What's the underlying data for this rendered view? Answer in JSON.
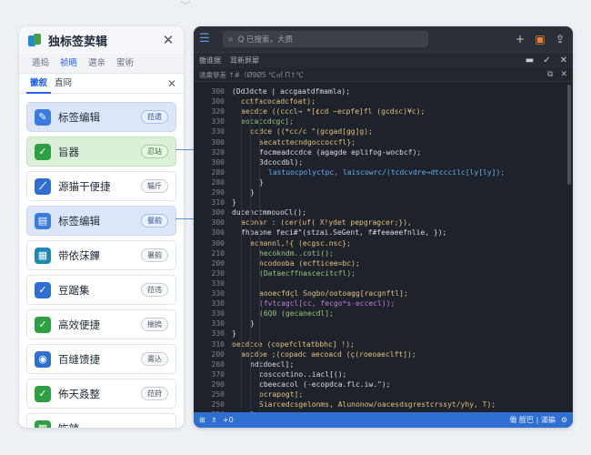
{
  "left": {
    "title": "独标签荬辑",
    "tabs": [
      "遁捣",
      "祯晤",
      "選亲",
      "蜜術"
    ],
    "subtabs": [
      "黴叙",
      "直冏"
    ],
    "items": [
      {
        "label": "标签编辑",
        "pill": "菈遗",
        "style": "blue",
        "icon": "tag-edit-icon",
        "color": "#3b7be0"
      },
      {
        "label": "旨器",
        "pill": "忍站",
        "style": "green",
        "icon": "check-icon",
        "color": "#2ea043"
      },
      {
        "label": "源猫干便捷",
        "pill": "辎斤",
        "style": "",
        "icon": "pen-icon",
        "color": "#2f6fd1"
      },
      {
        "label": "标签编辑",
        "pill": "餐韵",
        "style": "blue",
        "icon": "card-icon",
        "color": "#3b7be0"
      },
      {
        "label": "带依莯饆",
        "pill": "暑韵",
        "style": "",
        "icon": "building-icon",
        "color": "#1e88b0"
      },
      {
        "label": "豆踞集",
        "pill": "菈违",
        "style": "",
        "icon": "check-icon",
        "color": "#2f6fd1"
      },
      {
        "label": "高效便捷",
        "pill": "揣摀",
        "style": "",
        "icon": "check-icon",
        "color": "#2ea043"
      },
      {
        "label": "百缝馈捷",
        "pill": "晝込",
        "style": "",
        "icon": "user-icon",
        "color": "#2f6fd1"
      },
      {
        "label": "佈天叒整",
        "pill": "菈荮",
        "style": "",
        "icon": "check-icon",
        "color": "#2ea043"
      },
      {
        "label": "饬辣",
        "pill": "",
        "style": "",
        "icon": "building-icon",
        "color": "#2ea043"
      }
    ]
  },
  "right": {
    "search_placeholder": "Q 已搜索，大质",
    "bar2": [
      "雒谁据",
      "耳新屛犀"
    ],
    "bar3": "通羹孽差 ↑#（Ø9Ø5 ℃㎡ Π↑℃",
    "status_left": [
      "⊞",
      "♗",
      "+0"
    ],
    "status_right": "㒈 酲巴 | 滿徧",
    "line_numbers": [
      "300",
      "300",
      "320",
      "330",
      "330",
      "300",
      "320",
      "300",
      "280",
      "280",
      "290",
      "310",
      "300",
      "300",
      "300",
      "300",
      "210",
      "200",
      "230",
      "330",
      "330",
      "330",
      "330",
      "330",
      "330",
      "310",
      "200",
      "260",
      "370",
      "290",
      "250",
      "250",
      "210",
      "210",
      "230"
    ],
    "code_lines": [
      {
        "i": 0,
        "t": "(DdJdcte | accgaatdfmamla);",
        "c": "#d8dde5"
      },
      {
        "i": 1,
        "t": "cctfacocadcfoat);",
        "c": "#e5c07b"
      },
      {
        "i": 1,
        "t": "aecdce ((cccl→ *[¢cd ~ecpfe]fl (gcdsc)¥c);",
        "c": "#e5c07b"
      },
      {
        "i": 1,
        "t": "eocaccdcgc];",
        "c": "#98c379"
      },
      {
        "i": 2,
        "t": "ccdce ((*cc/c \"(gcgad[gg]g);",
        "c": "#e5c07b"
      },
      {
        "i": 3,
        "t": "secatctecndgoccoccfl};",
        "c": "#e5c07b"
      },
      {
        "i": 3,
        "t": "focmeadccdce (agagde eplifog-wocbcf);",
        "c": "#d8dde5"
      },
      {
        "i": 3,
        "t": "3dcocdbl);",
        "c": "#d8dde5"
      },
      {
        "i": 4,
        "t": "lastuocpolyctpc, laiscowrc/(tcdcvdre→dtcccilc[ly[ly]);",
        "c": "#61afef"
      },
      {
        "i": 3,
        "t": "}",
        "c": "#d8dde5"
      },
      {
        "i": 2,
        "t": "}",
        "c": "#d8dde5"
      },
      {
        "i": 0,
        "t": "}",
        "c": "#d8dde5"
      },
      {
        "i": 0,
        "t": "ducenctmmouoCl();",
        "c": "#d8dde5"
      },
      {
        "i": 1,
        "t": "aconar : (cer(uf( X!ydet pepgragcer;}),",
        "c": "#e5c07b"
      },
      {
        "i": 1,
        "t": "fhoabne feci#\"(stzai.SeGent, f#feeaeefnlie, });",
        "c": "#d8dde5"
      },
      {
        "i": 2,
        "t": "ecmannl,!{ (ecgsc.nsc};",
        "c": "#e5c07b"
      },
      {
        "i": 3,
        "t": "hecokndm..coti();",
        "c": "#98c379"
      },
      {
        "i": 3,
        "t": "ncodooba (ecfticee=bc);",
        "c": "#e5c07b"
      },
      {
        "i": 3,
        "t": "(Dataecffnascecitcfl);",
        "c": "#98c379"
      },
      {
        "i": 0,
        "t": "",
        "c": "#d8dde5"
      },
      {
        "i": 3,
        "t": "aooecfdçl Sogbo/ootoagg[racgnftl];",
        "c": "#e5c07b"
      },
      {
        "i": 3,
        "t": "(fvtcagcl[cc, fecgo*s-eccecl));",
        "c": "#c678dd"
      },
      {
        "i": 3,
        "t": "(6Q0 (gecanecdl];",
        "c": "#98c379"
      },
      {
        "i": 2,
        "t": "}",
        "c": "#d8dde5"
      },
      {
        "i": 0,
        "t": "}",
        "c": "#d8dde5"
      },
      {
        "i": 0,
        "t": "oecdcce (copefcltatbbhc] !);",
        "c": "#e5c07b"
      },
      {
        "i": 1,
        "t": "aocdoe ;(copadc aecoacd (ç(roeoaeclft]);",
        "c": "#e5c07b"
      },
      {
        "i": 2,
        "t": "ndcdoecl];",
        "c": "#d8dde5"
      },
      {
        "i": 3,
        "t": "cosccotino..iacl[();",
        "c": "#d8dde5"
      },
      {
        "i": 3,
        "t": "cbeecacol (-ecopdca.flc.iw.\");",
        "c": "#d8dde5"
      },
      {
        "i": 3,
        "t": "ocrapogt];",
        "c": "#e5c07b"
      },
      {
        "i": 3,
        "t": "Siarcedcsgelonms, Alunonow/oacesdsgrestcrssyt/yhy, T);",
        "c": "#e5c07b"
      },
      {
        "i": 2,
        "t": "}",
        "c": "#d8dde5"
      },
      {
        "i": 1,
        "t": "}",
        "c": "#d8dde5"
      },
      {
        "i": 1,
        "t": "}",
        "c": "#d8dde5"
      }
    ]
  }
}
